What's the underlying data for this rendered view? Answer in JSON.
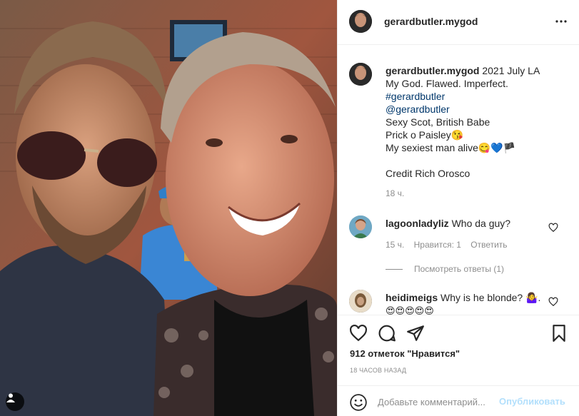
{
  "post": {
    "username": "gerardbutler.mygod",
    "more_icon": "more-horizontal-icon"
  },
  "caption": {
    "username": "gerardbutler.mygod",
    "first_line": " 2021 July LA",
    "lines": [
      "My God. Flawed. Imperfect."
    ],
    "hashtag": "#gerardbutler",
    "mention": "@gerardbutler",
    "lines2": [
      "Sexy Scot, British Babe",
      "Prick o Paisley😘",
      "My sexiest man alive😋💙🏴"
    ],
    "credit": "Credit Rich Orosco",
    "time": "18 ч."
  },
  "comments": [
    {
      "username": "lagoonladyliz",
      "text": " Who da guy?",
      "time": "15 ч.",
      "likes": "Нравится: 1",
      "reply": "Ответить",
      "view_replies": "Посмотреть ответы (1)"
    },
    {
      "username": "heidimeigs",
      "text": " Why is he blonde? 🤷‍♀️.",
      "emoji_line": "😍😍😍😍😍"
    }
  ],
  "actions": {
    "like_icon": "heart-icon",
    "comment_icon": "comment-icon",
    "share_icon": "send-icon",
    "save_icon": "bookmark-icon"
  },
  "likes_text": "912 отметок \"Нравится\"",
  "post_time": "18 ЧАСОВ НАЗАД",
  "comment_box": {
    "placeholder": "Добавьте комментарий...",
    "publish_label": "Опубликовать"
  },
  "colors": {
    "link": "#00376b",
    "muted": "#8e8e8e",
    "publish_disabled": "#b2dffc"
  }
}
